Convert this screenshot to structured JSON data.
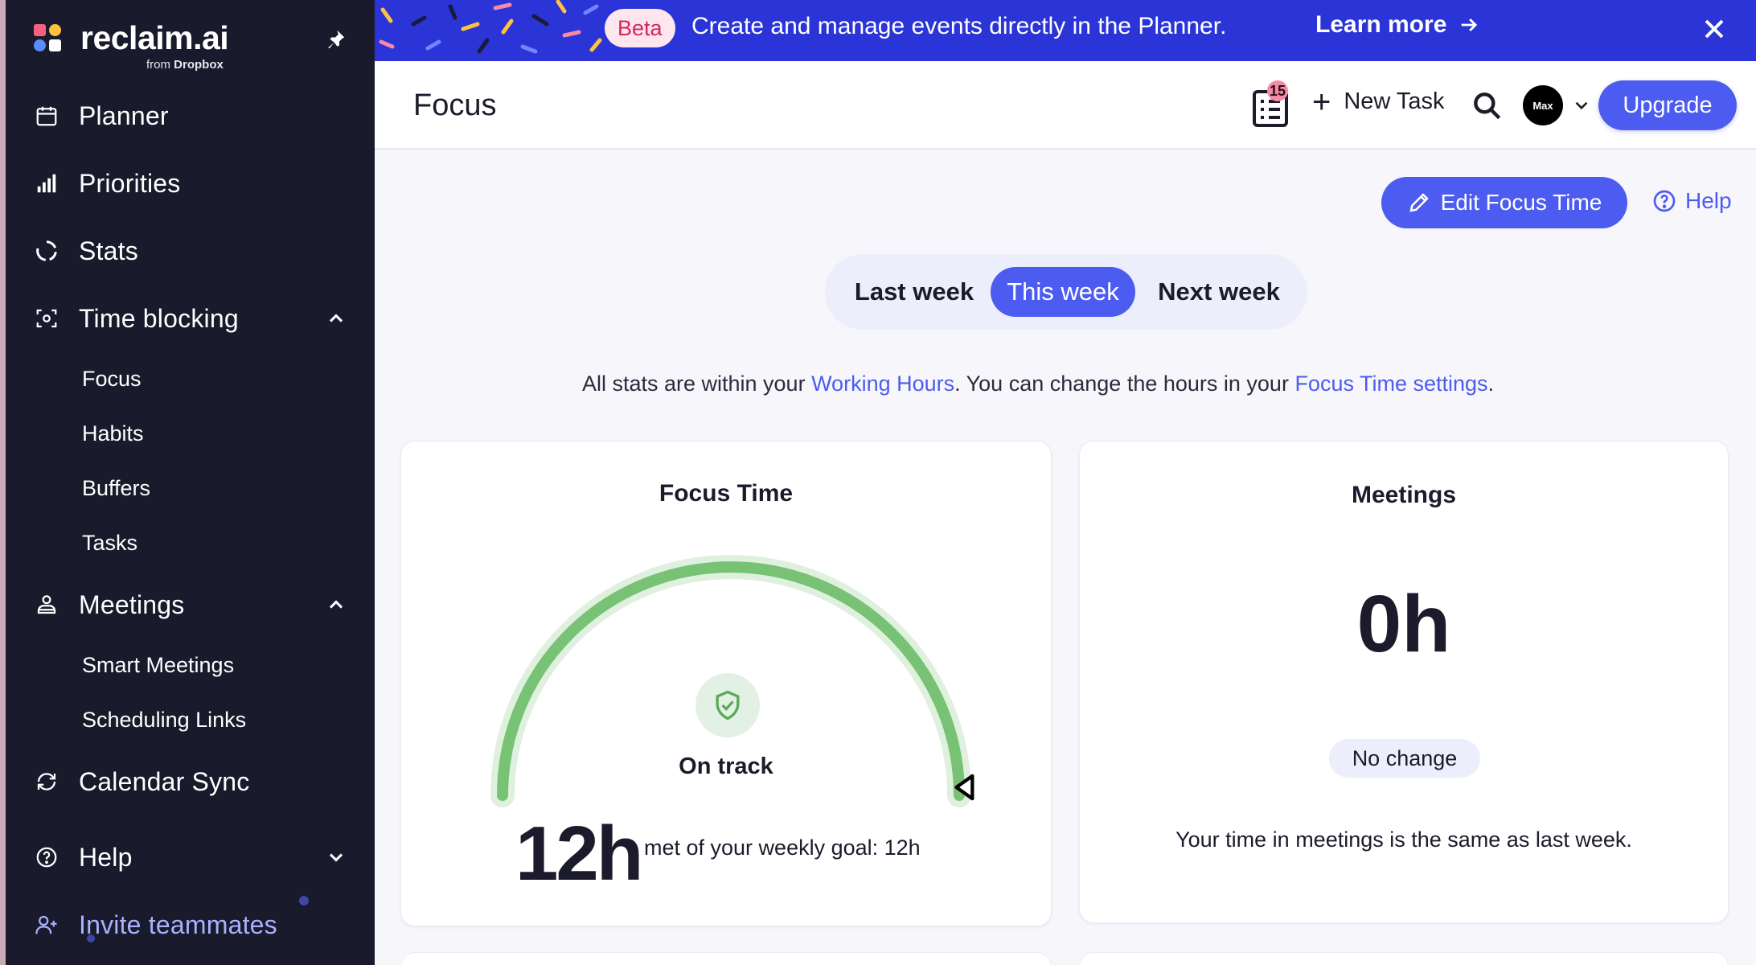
{
  "sidebar": {
    "brand": {
      "name": "reclaim.ai",
      "from": "from",
      "partner": "Dropbox"
    },
    "nav": {
      "planner": "Planner",
      "priorities": "Priorities",
      "stats": "Stats",
      "time_blocking": "Time blocking",
      "time_blocking_items": [
        "Focus",
        "Habits",
        "Buffers",
        "Tasks"
      ],
      "meetings": "Meetings",
      "meetings_items": [
        "Smart Meetings",
        "Scheduling Links"
      ],
      "calendar_sync": "Calendar Sync",
      "help": "Help",
      "invite": "Invite teammates"
    }
  },
  "banner": {
    "badge": "Beta",
    "message": "Create and manage events directly in the Planner.",
    "link": "Learn more"
  },
  "header": {
    "title": "Focus",
    "tasks_badge": "15",
    "new_task": "New Task",
    "avatar_text": "Max",
    "upgrade": "Upgrade"
  },
  "main": {
    "edit_button": "Edit Focus Time",
    "help_link": "Help",
    "weeks": [
      "Last week",
      "This week",
      "Next week"
    ],
    "active_week": "This week",
    "info": {
      "part1": "All stats are within your ",
      "link1": "Working Hours",
      "part2": ". You can change the hours in your ",
      "link2": "Focus Time settings",
      "part3": "."
    },
    "focus_card": {
      "title": "Focus Time",
      "status": "On track",
      "hours": "12h",
      "goal_text": "met of your weekly goal: 12h",
      "progress_fraction": 1.0
    },
    "meetings_card": {
      "title": "Meetings",
      "value": "0h",
      "badge": "No change",
      "description": "Your time in meetings is the same as last week."
    }
  },
  "colors": {
    "sidebar_bg": "#191a2b",
    "banner_bg": "#2b34d6",
    "accent": "#4d5cf0",
    "gauge_green": "#77c274",
    "gauge_track": "#dff0de"
  }
}
